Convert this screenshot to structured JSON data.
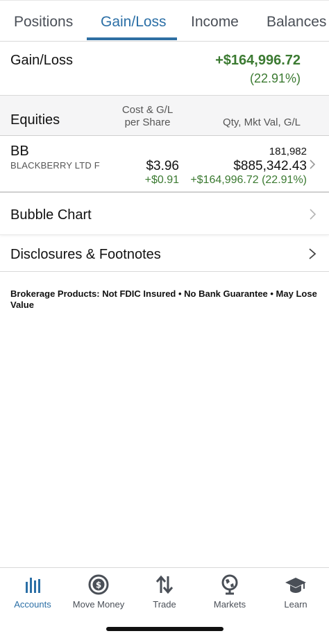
{
  "tabs": [
    {
      "label": "Positions"
    },
    {
      "label": "Gain/Loss"
    },
    {
      "label": "Income"
    },
    {
      "label": "Balances"
    }
  ],
  "active_tab": "Gain/Loss",
  "summary": {
    "label": "Gain/Loss",
    "value": "+$164,996.72",
    "percent": "(22.91%)"
  },
  "equities_header": {
    "title": "Equities",
    "cost_col_line1": "Cost & G/L",
    "cost_col_line2": "per Share",
    "qty_col": "Qty, Mkt Val, G/L"
  },
  "holding": {
    "symbol": "BB",
    "name": "BLACKBERRY LTD F",
    "cost_per_share": "$3.96",
    "gl_per_share": "+$0.91",
    "quantity": "181,982",
    "market_value": "$885,342.43",
    "gain_loss": "+$164,996.72 (22.91%)"
  },
  "links": {
    "bubble_chart": "Bubble Chart",
    "disclosures": "Disclosures & Footnotes"
  },
  "disclaimer": "Brokerage Products: Not FDIC Insured • No Bank Guarantee • May Lose Value",
  "bottom_nav": [
    {
      "label": "Accounts",
      "icon": "bar-chart-icon"
    },
    {
      "label": "Move Money",
      "icon": "dollar-circle-icon"
    },
    {
      "label": "Trade",
      "icon": "up-down-arrows-icon"
    },
    {
      "label": "Markets",
      "icon": "globe-icon"
    },
    {
      "label": "Learn",
      "icon": "graduation-cap-icon"
    }
  ],
  "colors": {
    "accent": "#2b6fa6",
    "gain": "#3b7a31",
    "icon": "#4a4f57"
  }
}
